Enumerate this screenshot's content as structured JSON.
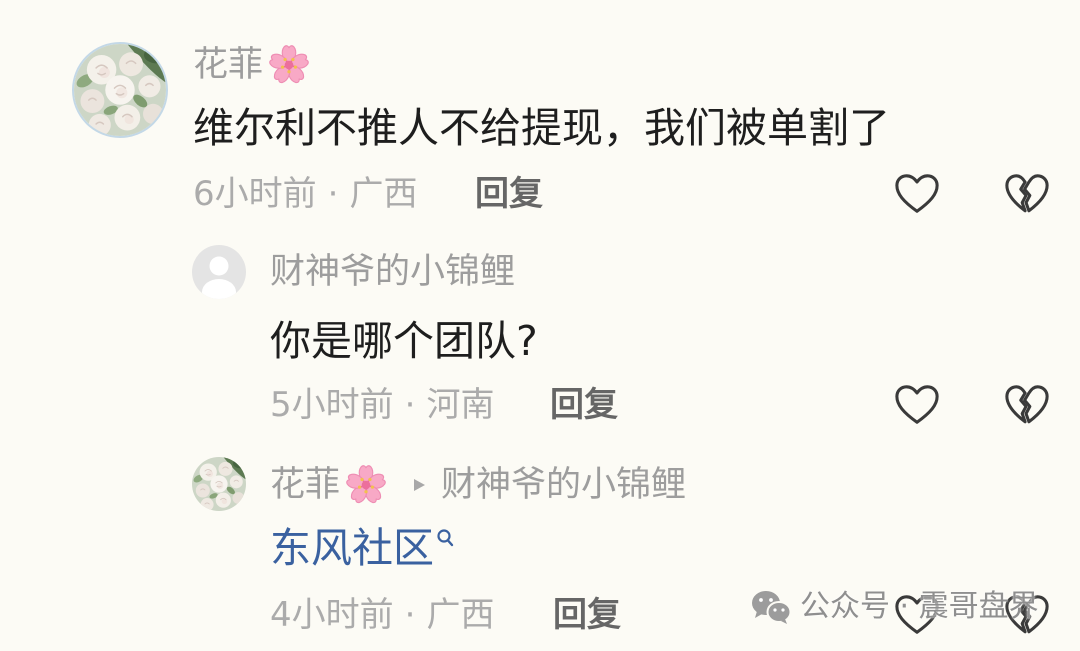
{
  "separator": "·",
  "comment": {
    "avatar_icon": "flower-avatar-icon",
    "username": "花菲",
    "username_icon": "cherry-blossom-icon",
    "text": "维尔利不推人不给提现，我们被单割了",
    "time": "6小时前",
    "location": "广西",
    "reply_label": "回复",
    "like_icon": "heart-outline-icon",
    "dislike_icon": "broken-heart-icon"
  },
  "replies": [
    {
      "avatar_icon": "default-user-avatar-icon",
      "username": "财神爷的小锦鲤",
      "text": "你是哪个团队?",
      "time": "5小时前",
      "location": "河南",
      "reply_label": "回复",
      "like_icon": "heart-outline-icon",
      "dislike_icon": "broken-heart-icon"
    },
    {
      "avatar_icon": "flower-avatar-icon",
      "username": "花菲",
      "username_icon": "cherry-blossom-icon",
      "reply_to_icon": "play-triangle-icon",
      "reply_to": "财神爷的小锦鲤",
      "text": "东风社区",
      "text_icon": "search-icon",
      "time": "4小时前",
      "location": "广西",
      "reply_label": "回复",
      "like_icon": "heart-outline-icon",
      "dislike_icon": "broken-heart-icon"
    }
  ],
  "watermark": {
    "icon": "wechat-icon",
    "text": "公众号 · 震哥盘界"
  },
  "colors": {
    "background": "#fcfbf5",
    "username": "#9d9d9d",
    "body_text": "#1e1e1e",
    "meta_text": "#ababab",
    "reply_button": "#666666",
    "link_text": "#3a61a0",
    "icon_stroke": "#3a3a3a",
    "watermark": "#8f8f8f"
  }
}
